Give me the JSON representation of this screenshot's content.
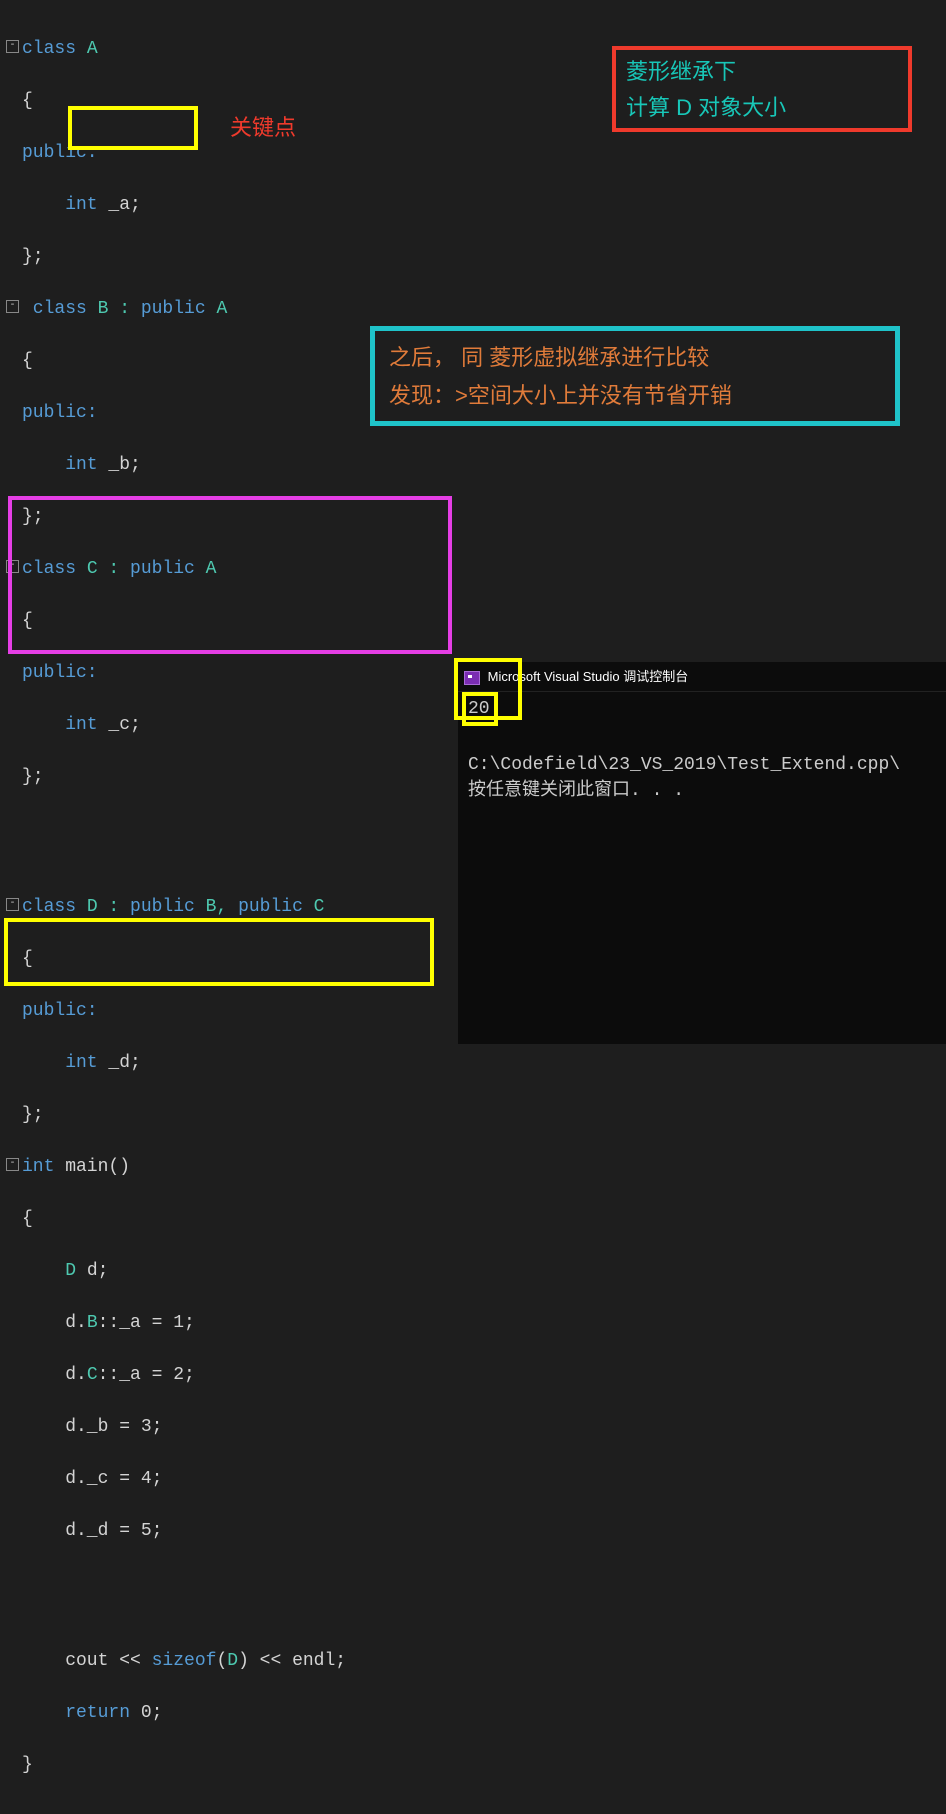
{
  "annotations": {
    "keypoint": "关键点",
    "redbox_line1": "菱形继承下",
    "redbox_line2": "计算 D 对象大小",
    "tealbox_line1": "之后，  同 菱形虚拟继承进行比较",
    "tealbox_line2": "发现：>空间大小上并没有节省开销"
  },
  "code": {
    "classA_decl_1": "class",
    "classA_decl_2": " A",
    "lbrace": "{",
    "public_colon": "public:",
    "int_a": "    int",
    "a_name": " _a;",
    "rbrace_semi": "};",
    "classB_decl_1": " class",
    "classB_decl_2": " B : ",
    "classB_decl_3": "public",
    "classB_decl_4": " A",
    "int_b_kw": "    int",
    "int_b_name": " _b;",
    "classC_decl_1": "class",
    "classC_decl_2": " C : ",
    "classC_decl_3": "public",
    "classC_decl_4": " A",
    "int_c_kw": "    int",
    "int_c_name": " _c;",
    "classD_decl_1": "class",
    "classD_decl_2": " D : ",
    "classD_decl_3": "public",
    "classD_decl_4": " B, ",
    "classD_decl_5": "public",
    "classD_decl_6": " C",
    "int_d_kw": "    int",
    "int_d_name": " _d;",
    "main_decl_1": "int",
    "main_decl_2": " main()",
    "body_d_decl_1": "    D",
    "body_d_decl_2": " d;",
    "body_l1": "    d.B::_a = 1;",
    "body_l1_pre": "    d.",
    "body_l1_B": "B",
    "body_l1_post": "::_a = 1;",
    "body_l2_pre": "    d.",
    "body_l2_C": "C",
    "body_l2_post": "::_a = 2;",
    "body_l3": "    d._b = 3;",
    "body_l4": "    d._c = 4;",
    "body_l5": "    d._d = 5;",
    "blank": "",
    "cout_1": "    cout << ",
    "cout_2": "sizeof",
    "cout_3": "(",
    "cout_4": "D",
    "cout_5": ") << endl;",
    "ret_1": "    return",
    "ret_2": " 0;",
    "close_brace": "}"
  },
  "console": {
    "title": "Microsoft Visual Studio 调试控制台",
    "output_value": "20",
    "path_line": "C:\\Codefield\\23_VS_2019\\Test_Extend.cpp\\",
    "prompt_line": "按任意键关闭此窗口. . ."
  }
}
